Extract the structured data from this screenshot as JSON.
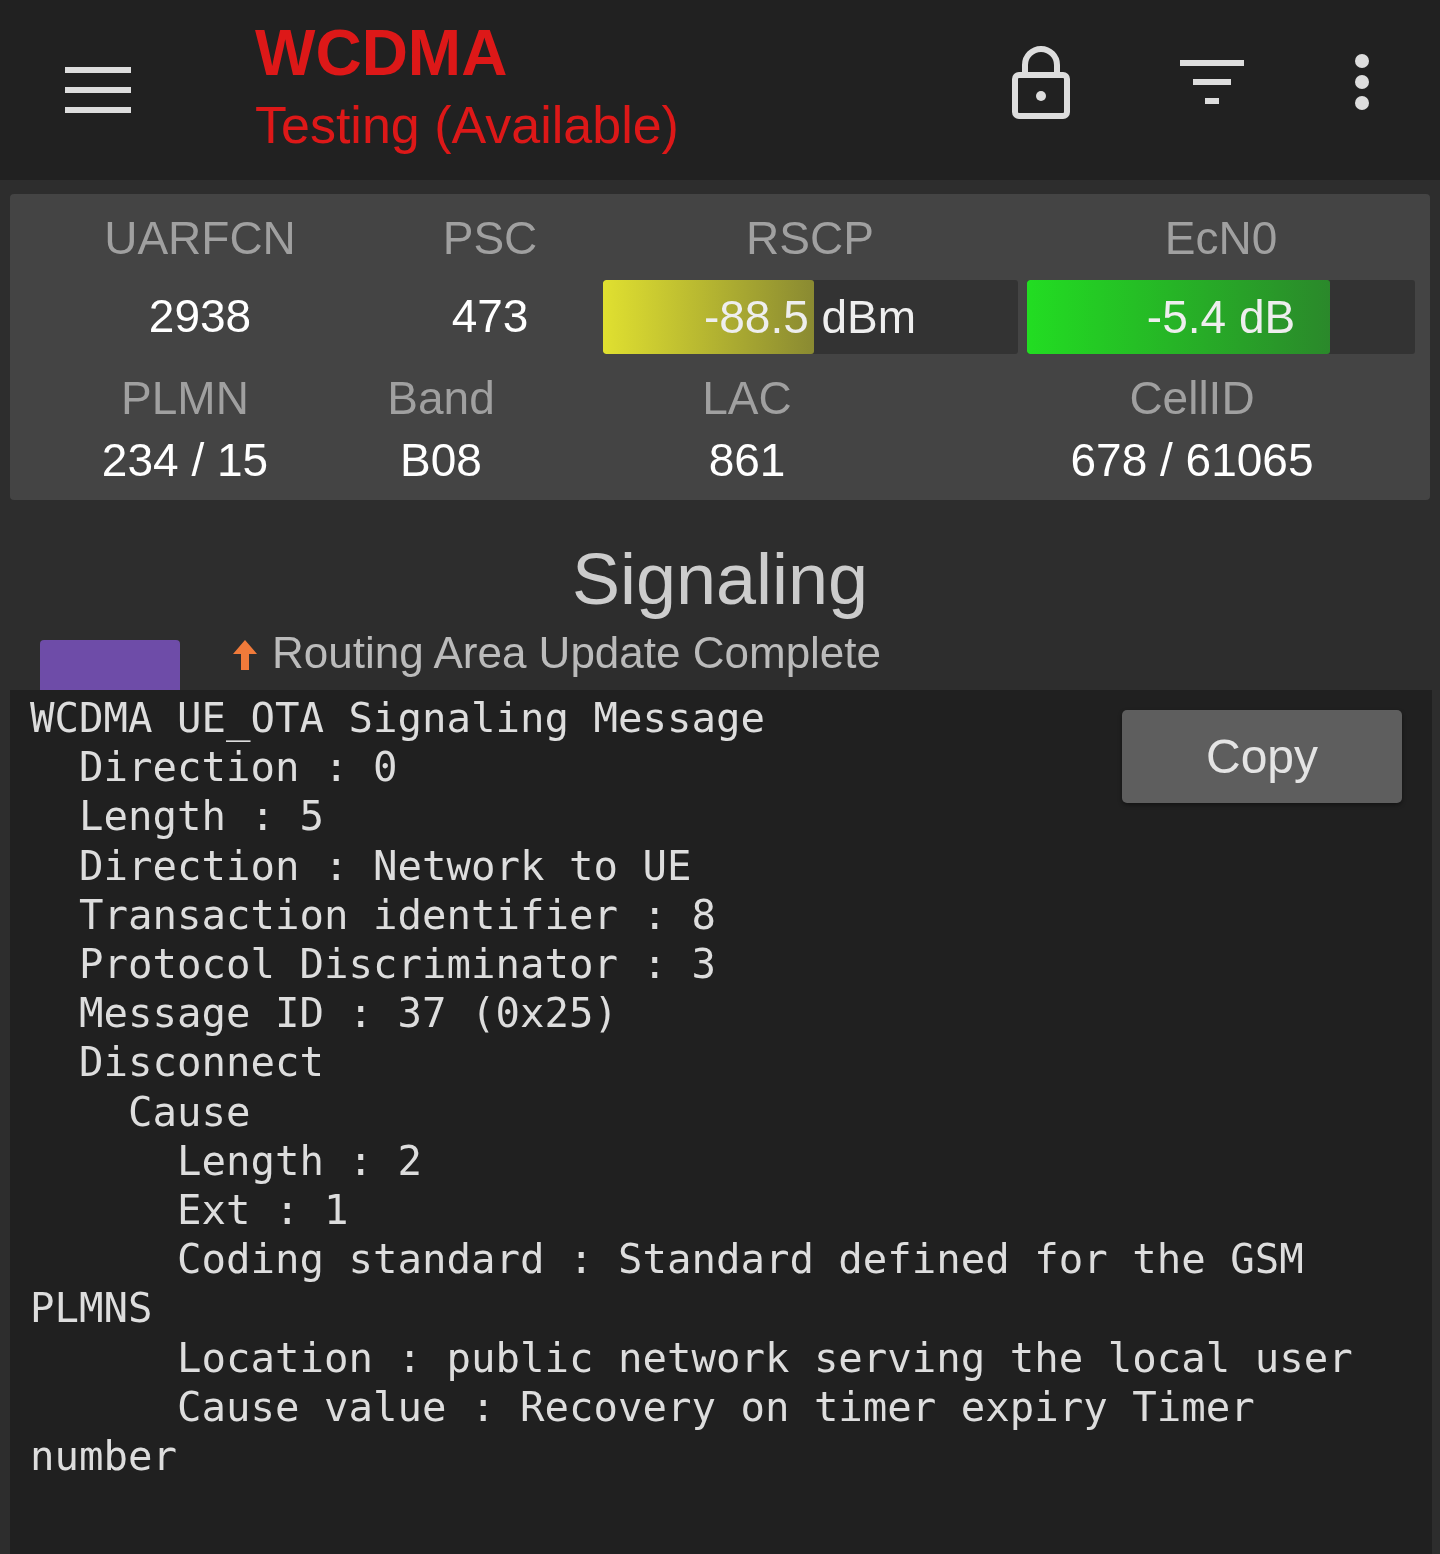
{
  "app_bar": {
    "title": "WCDMA",
    "subtitle": "Testing (Available)"
  },
  "cell_info": {
    "row_1": [
      {
        "kind": "text",
        "label": "UARFCN",
        "value": "2938"
      },
      {
        "kind": "text",
        "label": "PSC",
        "value": "473"
      },
      {
        "kind": "meter",
        "label": "RSCP",
        "value": "-88.5 dBm",
        "level": 0.51,
        "color": "#e0e030"
      },
      {
        "kind": "meter",
        "label": "EcN0",
        "value": "-5.4 dB",
        "level": 0.78,
        "color": "#22dd22"
      }
    ],
    "row_2": [
      {
        "kind": "text",
        "label": "PLMN",
        "value": "234 / 15"
      },
      {
        "kind": "text",
        "label": "Band",
        "value": "B08"
      },
      {
        "kind": "text",
        "label": "LAC",
        "value": "861"
      },
      {
        "kind": "text",
        "label": "CellID",
        "value": "678 / 61065"
      }
    ]
  },
  "section_title": "Signaling",
  "signaling_list": [
    {
      "kind": "up",
      "title": "Routing Area Update Complete",
      "color": "#6e4ca8"
    }
  ],
  "detail_popup": {
    "lines": [
      "WCDMA UE_OTA Signaling Message",
      "  Direction : 0",
      "  Length : 5",
      "  Direction : Network to UE",
      "  Transaction identifier : 8",
      "  Protocol Discriminator : 3",
      "  Message ID : 37 (0x25)",
      "  Disconnect",
      "    Cause",
      "      Length : 2",
      "      Ext : 1",
      "      Coding standard : Standard defined for the GSM PLMNS",
      "      Location : public network serving the local user",
      "      Cause value : Recovery on timer expiry Timer number"
    ],
    "button": "Copy"
  }
}
